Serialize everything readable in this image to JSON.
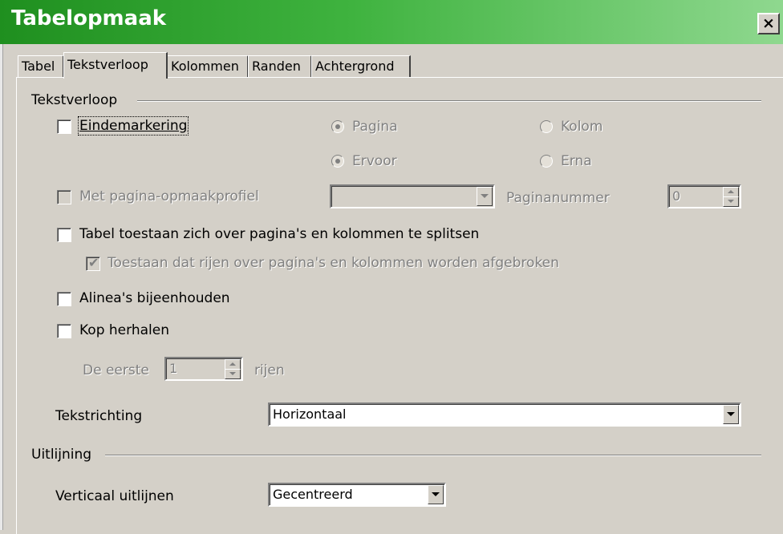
{
  "window": {
    "title": "Tabelopmaak",
    "close_label": "×"
  },
  "tabs": [
    {
      "label": "Tabel",
      "active": false
    },
    {
      "label": "Tekstverloop",
      "active": true
    },
    {
      "label": "Kolommen",
      "active": false
    },
    {
      "label": "Randen",
      "active": false
    },
    {
      "label": "Achtergrond",
      "active": false
    }
  ],
  "text_flow": {
    "group_label": "Tekstverloop",
    "break": {
      "label": "Eindemarkering",
      "checked": false
    },
    "type_page": {
      "label": "Pagina",
      "selected": true,
      "enabled": false
    },
    "type_column": {
      "label": "Kolom",
      "selected": false,
      "enabled": false
    },
    "position_before": {
      "label": "Ervoor",
      "selected": true,
      "enabled": false
    },
    "position_after": {
      "label": "Erna",
      "selected": false,
      "enabled": false
    },
    "page_style": {
      "label": "Met pagina-opmaakprofiel",
      "checked": false,
      "enabled": false,
      "value": ""
    },
    "page_number": {
      "label": "Paginanummer",
      "value": "0"
    },
    "allow_split": {
      "label": "Tabel toestaan zich over pagina's en kolommen te splitsen",
      "checked": false
    },
    "allow_row_break": {
      "label": "Toestaan dat rijen over pagina's en kolommen worden afgebroken",
      "checked": true,
      "enabled": false
    },
    "keep_with_next": {
      "label": "Alinea's bijeenhouden",
      "checked": false
    },
    "repeat_heading": {
      "label": "Kop herhalen",
      "checked": false
    },
    "first_rows": {
      "label": "De eerste",
      "value": "1",
      "suffix": "rijen"
    },
    "text_direction": {
      "label": "Tekstrichting",
      "value": "Horizontaal"
    }
  },
  "alignment": {
    "group_label": "Uitlijning",
    "vertical": {
      "label": "Verticaal uitlijnen",
      "value": "Gecentreerd"
    }
  }
}
